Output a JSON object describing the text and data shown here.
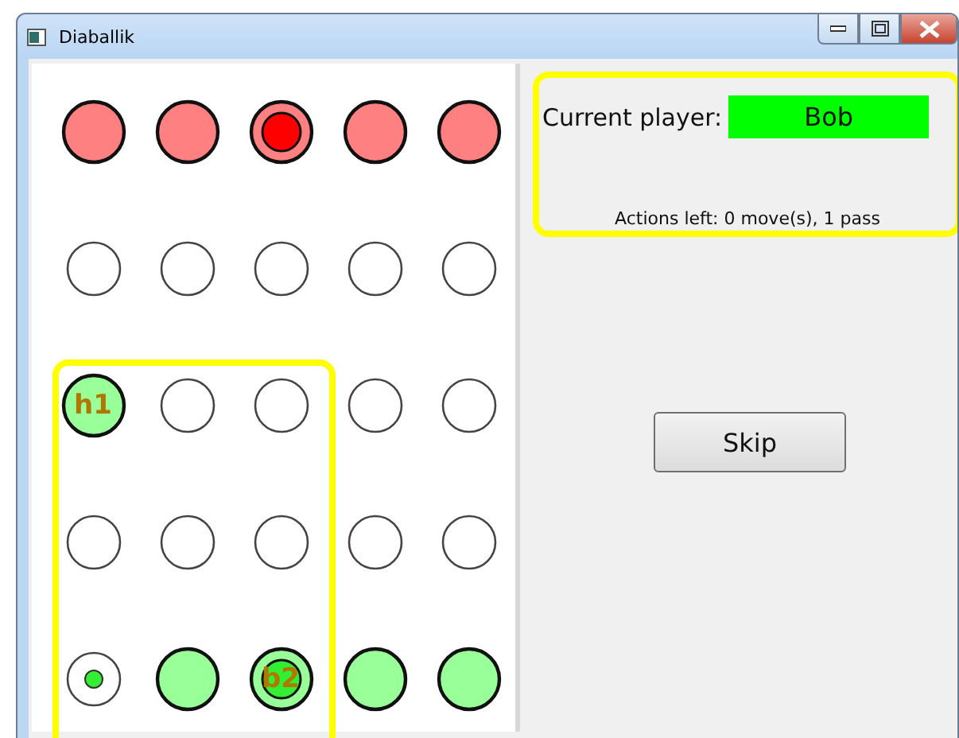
{
  "window": {
    "title": "Diaballik"
  },
  "board": {
    "highlight_frame": true,
    "rows": [
      {
        "cells": [
          {
            "kind": "piece",
            "color": "#ff8080"
          },
          {
            "kind": "piece",
            "color": "#ff8080"
          },
          {
            "kind": "piece-ball",
            "color": "#ff8080",
            "ball": {
              "color": "#ff0000"
            }
          },
          {
            "kind": "piece",
            "color": "#ff8080"
          },
          {
            "kind": "piece",
            "color": "#ff8080"
          }
        ]
      },
      {
        "cells": [
          {
            "kind": "empty"
          },
          {
            "kind": "empty"
          },
          {
            "kind": "empty"
          },
          {
            "kind": "empty"
          },
          {
            "kind": "empty"
          }
        ]
      },
      {
        "cells": [
          {
            "kind": "piece",
            "color": "#99ff99",
            "label": "h1"
          },
          {
            "kind": "empty"
          },
          {
            "kind": "empty"
          },
          {
            "kind": "empty"
          },
          {
            "kind": "empty"
          }
        ]
      },
      {
        "cells": [
          {
            "kind": "empty"
          },
          {
            "kind": "empty"
          },
          {
            "kind": "empty"
          },
          {
            "kind": "empty"
          },
          {
            "kind": "empty"
          }
        ]
      },
      {
        "cells": [
          {
            "kind": "target",
            "ball": {
              "color": "#33ee33"
            }
          },
          {
            "kind": "piece",
            "color": "#99ff99"
          },
          {
            "kind": "piece-ball",
            "color": "#99ff99",
            "ball": {
              "color": "#33ee33"
            },
            "label": "b2"
          },
          {
            "kind": "piece",
            "color": "#99ff99"
          },
          {
            "kind": "piece",
            "color": "#99ff99"
          }
        ]
      }
    ]
  },
  "info": {
    "highlighted": true,
    "label": "Current player:",
    "player": "Bob",
    "actions": "Actions left: 0 move(s), 1 pass"
  },
  "buttons": [
    {
      "label": "Skip"
    }
  ]
}
